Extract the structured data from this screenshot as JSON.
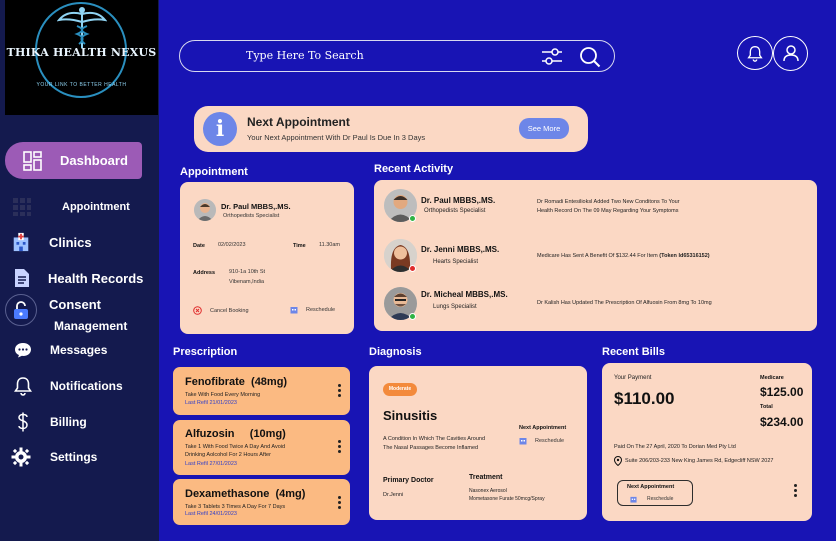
{
  "brand": {
    "name": "THIKA HEALTH NEXUS",
    "tagline": "YOUR LINK TO BETTER HEALTH"
  },
  "sidebar": {
    "items": [
      {
        "label": "Dashboard",
        "icon": "grid-icon"
      },
      {
        "label": "Appointment",
        "icon": "calendar-icon"
      },
      {
        "label": "Clinics",
        "icon": "hospital-icon"
      },
      {
        "label": "Health Records",
        "icon": "document-icon"
      },
      {
        "label": "Consent",
        "label2": "Management",
        "icon": "lock-icon"
      },
      {
        "label": "Messages",
        "icon": "chat-icon"
      },
      {
        "label": "Notifications",
        "icon": "bell-icon"
      },
      {
        "label": "Billing",
        "icon": "dollar-icon"
      },
      {
        "label": "Settings",
        "icon": "gear-icon"
      }
    ]
  },
  "search": {
    "placeholder": "Type Here To Search"
  },
  "banner": {
    "title": "Next Appointment",
    "subtitle": "Your Next Appointment With Dr Paul Is Due In 3 Days",
    "button": "See More"
  },
  "appointment": {
    "section_title": "Appointment",
    "doctor": "Dr. Paul MBBS,.MS.",
    "specialty": "Orthopedists  Specialist",
    "date_label": "Date",
    "date": "02/02/2023",
    "time_label": "Time",
    "time": "11.30am",
    "address_label": "Address",
    "address_line1": "910-1a 10th St",
    "address_line2": "Vibenam,India",
    "cancel": "Cancel Booking",
    "reschedule": "Reschedule"
  },
  "activity": {
    "section_title": "Recent Activity",
    "items": [
      {
        "name": "Dr. Paul MBBS,.MS.",
        "specialty": "Orthopedists  Specialist",
        "status_color": "#2fb344",
        "desc1": "Dr Romadi Entesilioksl Added Two New Conditons To Your",
        "desc2": "Health Record On The 09 May Regarding Your Symptoms"
      },
      {
        "name": "Dr. Jenni MBBS,.MS.",
        "specialty": "Hearts   Specialist",
        "status_color": "#e02b2b",
        "desc1": "Medicare Has Sent A Benefit Of $132.44 For Item",
        "desc_bold": "(Token Id65316152)"
      },
      {
        "name": "Dr. Micheal MBBS,.MS.",
        "specialty": "Lungs  Specialist",
        "status_color": "#2fb344",
        "desc1": "Dr Kalish Has Updated The Prescription Of Alfuosin From 8mg To 10mg"
      }
    ]
  },
  "prescription": {
    "section_title": "Prescription",
    "items": [
      {
        "name": "Fenofibrate",
        "dose": "(48mg)",
        "note1": "Take With Food Every Morning",
        "note2": "",
        "refill": "Last Refil 21/01/2023"
      },
      {
        "name": "Alfuzosin",
        "dose": "(10mg)",
        "note1": "Take 1 With Food Twice A Day And Avoid",
        "note2": "Drinking Aolcohol For 2 Hours After",
        "refill": "Last Refil 27/01/2023"
      },
      {
        "name": "Dexamethasone",
        "dose": "(4mg)",
        "note1": "Take 3 Tablets 3 Times A Day For 7 Days",
        "note2": "",
        "refill": "Last Refil 24/01/2023"
      }
    ]
  },
  "diagnosis": {
    "section_title": "Diagnosis",
    "badge": "Moderate",
    "title": "Sinusitis",
    "description": "A Condition In Which The Cavities Around The Nasal Passages Become Inflamed",
    "next_label": "Next Appointment",
    "reschedule": "Reschedule",
    "doctor_label": "Primary Doctor",
    "doctor": "Dr.Jenni",
    "treatment_label": "Treatment",
    "treatment1": "Nasonex Aerosol",
    "treatment2": "Mometasone Furate 50mcg/Spray"
  },
  "bills": {
    "section_title": "Recent Bills",
    "payment_label": "Your Payment",
    "payment": "$110.00",
    "medicare_label": "Medicare",
    "medicare": "$125.00",
    "total_label": "Total",
    "total": "$234.00",
    "paid_text": "Paid On The 27 April, 2020 To Dorian Med Pty Ltd",
    "address": "Suite 206/203-233 New King James Rd, Edgecliff NSW 2027",
    "next_label": "Next Appointment",
    "reschedule": "Reschedule"
  },
  "colors": {
    "background": "#1814b4",
    "sidebar": "#141a4e",
    "card": "#fbd8c4",
    "prescription": "#fbba82",
    "accent": "#6d86e8",
    "active_nav": "#9c5bb6"
  }
}
